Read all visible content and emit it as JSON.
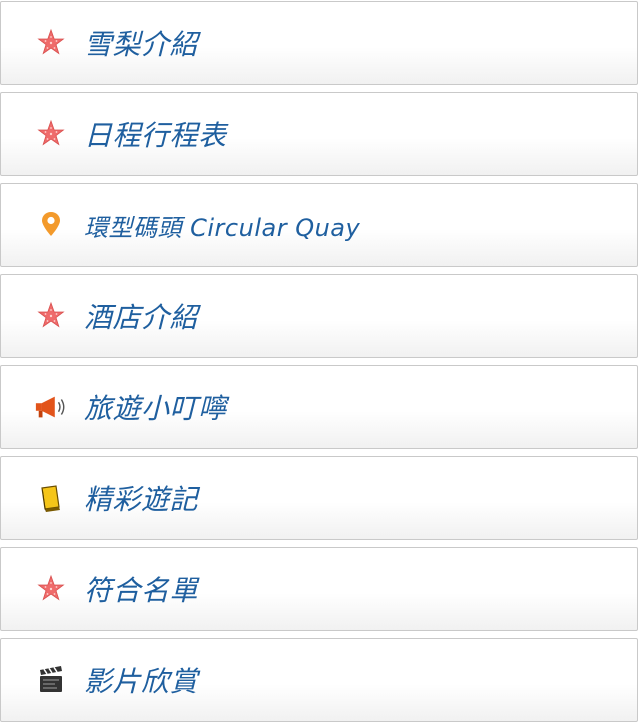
{
  "menu": {
    "items": [
      {
        "label": "雪梨介紹",
        "icon": "starfish-icon"
      },
      {
        "label": "日程行程表",
        "icon": "starfish-icon"
      },
      {
        "label": "環型碼頭 Circular Quay",
        "icon": "map-pin-icon"
      },
      {
        "label": "酒店介紹",
        "icon": "starfish-icon"
      },
      {
        "label": "旅遊小叮嚀",
        "icon": "megaphone-icon"
      },
      {
        "label": "精彩遊記",
        "icon": "book-icon"
      },
      {
        "label": "符合名單",
        "icon": "starfish-icon"
      },
      {
        "label": "影片欣賞",
        "icon": "clapperboard-icon"
      }
    ]
  },
  "colors": {
    "label_text": "#1f5f9f",
    "starfish": "#ef6b6b",
    "map_pin": "#f39a2b",
    "megaphone": "#e2541b",
    "book": "#f5c518"
  }
}
